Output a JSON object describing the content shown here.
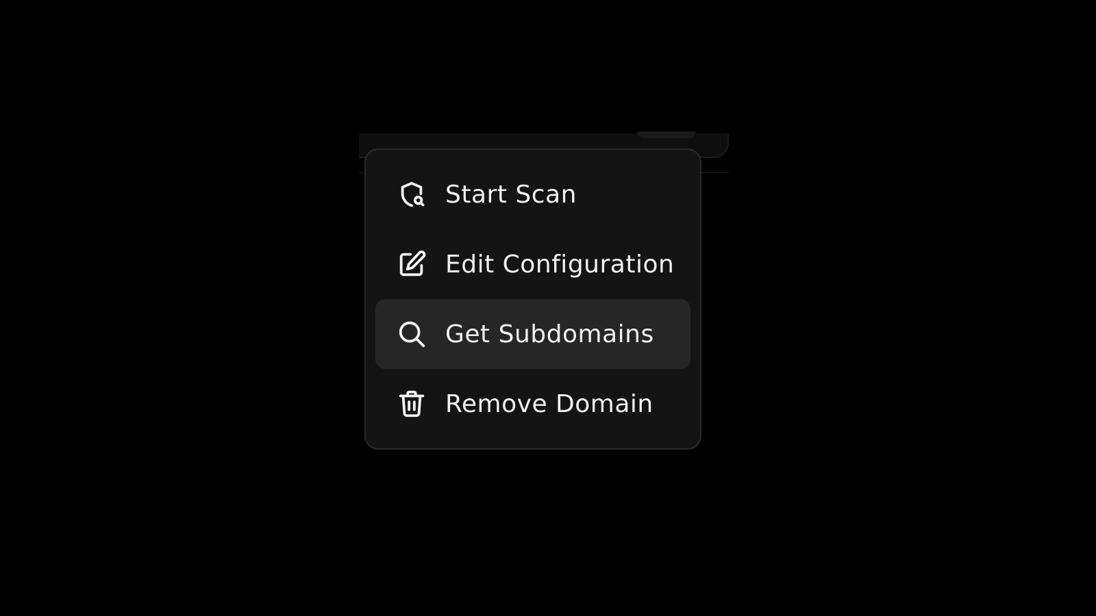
{
  "menu": {
    "highlighted_index": 2,
    "items": [
      {
        "label": "Start Scan",
        "icon": "shield-search-icon"
      },
      {
        "label": "Edit Configuration",
        "icon": "edit-icon"
      },
      {
        "label": "Get Subdomains",
        "icon": "search-icon"
      },
      {
        "label": "Remove Domain",
        "icon": "trash-icon"
      }
    ]
  },
  "colors": {
    "background": "#000000",
    "menu_background": "#141414",
    "menu_border": "#2a2a2a",
    "highlight_background": "#262626",
    "text": "#f2f2f2"
  }
}
